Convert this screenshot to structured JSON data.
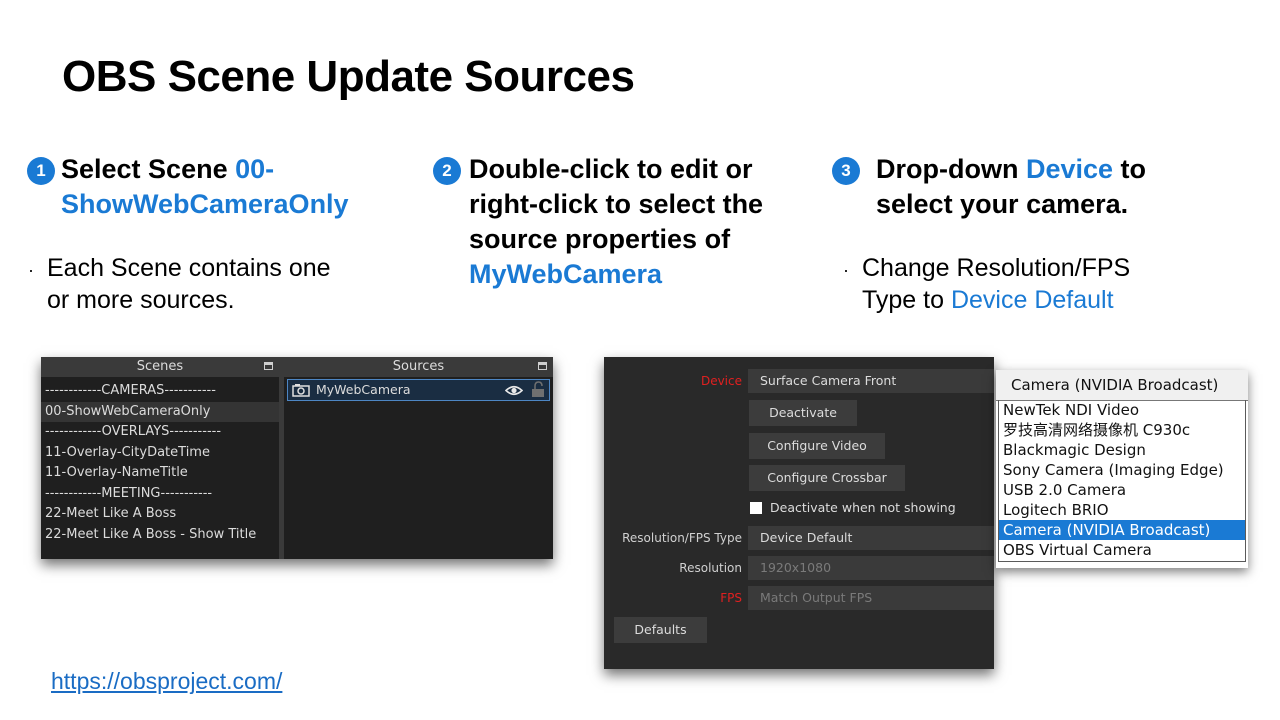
{
  "title": "OBS Scene Update Sources",
  "steps": [
    {
      "num": "1",
      "text": "Select Scene ",
      "highlight": "00-ShowWebCameraOnly",
      "highlight_a": "00-",
      "highlight_b": "ShowWebCameraOnly"
    },
    {
      "num": "2",
      "line1": "Double-click to edit or",
      "line2": "right-click to select the",
      "line3": "source properties of",
      "highlight": "MyWebCamera"
    },
    {
      "num": "3",
      "line1a": "Drop-down ",
      "line1b": "Device",
      "line1c": " to",
      "line2": "select your camera."
    }
  ],
  "bullets": {
    "b1_line1": "Each Scene contains one",
    "b1_line2": "or more sources.",
    "b3_line1": "Change Resolution/FPS",
    "b3_line2a": "Type to ",
    "b3_line2b": "Device Default",
    "dot": "·"
  },
  "scenes_panel": {
    "header": "Scenes",
    "items": [
      "------------CAMERAS-----------",
      "00-ShowWebCameraOnly",
      "------------OVERLAYS-----------",
      "11-Overlay-CityDateTime",
      "11-Overlay-NameTitle",
      "------------MEETING-----------",
      "22-Meet Like A Boss",
      "22-Meet Like A Boss - Show Title"
    ],
    "selected": "00-ShowWebCameraOnly"
  },
  "sources_panel": {
    "header": "Sources",
    "items": [
      "MyWebCamera"
    ]
  },
  "properties": {
    "device_label": "Device",
    "device_value": "Surface Camera Front",
    "deactivate_button": "Deactivate",
    "configure_video_button": "Configure Video",
    "configure_crossbar_button": "Configure Crossbar",
    "deactivate_checkbox_label": "Deactivate when not showing",
    "resfps_label": "Resolution/FPS Type",
    "resfps_value": "Device Default",
    "resolution_label": "Resolution",
    "resolution_value": "1920x1080",
    "fps_label": "FPS",
    "fps_value": "Match Output FPS",
    "defaults_button": "Defaults"
  },
  "device_dropdown": {
    "selected": "Camera (NVIDIA Broadcast)",
    "options": [
      "NewTek NDI Video",
      "罗技高清网络摄像机 C930c",
      "Blackmagic Design",
      "Sony Camera (Imaging Edge)",
      "USB 2.0 Camera",
      "Logitech BRIO",
      "Camera (NVIDIA Broadcast)",
      "OBS Virtual Camera"
    ]
  },
  "link": "https://obsproject.com/",
  "colors": {
    "accent": "#1a7ad4",
    "panel_bg": "#1f1f1f",
    "required_label": "#e02020"
  }
}
